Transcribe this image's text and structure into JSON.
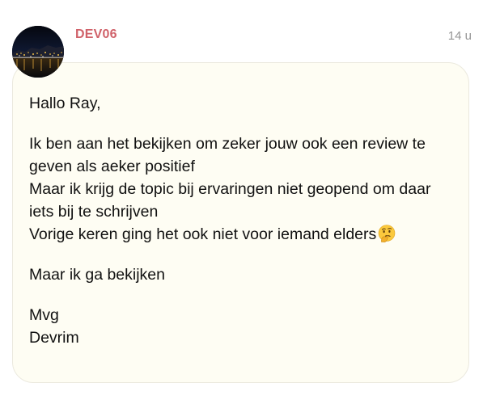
{
  "post": {
    "username": "DEV06",
    "timestamp": "14 u",
    "avatar_icon": "avatar-night-harbor-photo",
    "body": {
      "greeting": "Hallo Ray,",
      "paragraph1": {
        "line1": "Ik ben aan het bekijken om zeker jouw ook een review te geven als aeker positief",
        "line2": "Maar ik krijg de topic bij ervaringen niet geopend om daar iets bij te schrijven",
        "line3": "Vorige keren ging het ook niet voor iemand elders",
        "line3_emoji": "thinking-face-icon"
      },
      "paragraph2": "Maar ik ga bekijken",
      "signoff": {
        "line1": "Mvg",
        "line2": "Devrim"
      }
    }
  },
  "colors": {
    "username": "#d0626a",
    "timestamp": "#959595",
    "bubble_background": "#fefdf3",
    "bubble_border": "#ebe9de",
    "text": "#111111"
  }
}
